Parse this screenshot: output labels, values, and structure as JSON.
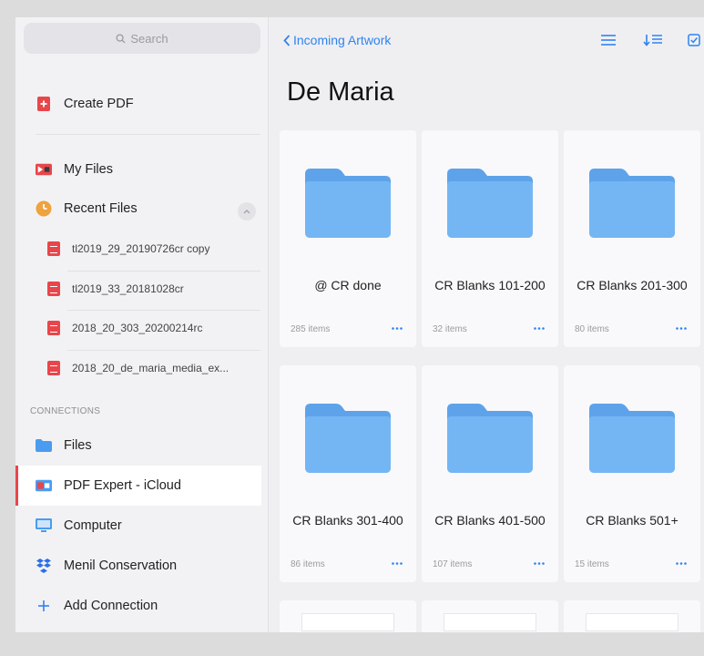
{
  "sidebar": {
    "search_placeholder": "Search",
    "create_pdf": "Create PDF",
    "my_files": "My Files",
    "recent_files": "Recent Files",
    "recent": [
      "tl2019_29_20190726cr copy",
      "tl2019_33_20181028cr",
      "2018_20_303_20200214rc",
      "2018_20_de_maria_media_ex..."
    ],
    "connections_title": "CONNECTIONS",
    "connections": [
      {
        "label": "Files",
        "icon": "folder-icon"
      },
      {
        "label": "PDF Expert - iCloud",
        "icon": "pdf-expert-cloud-icon"
      },
      {
        "label": "Computer",
        "icon": "computer-icon"
      },
      {
        "label": "Menil Conservation",
        "icon": "dropbox-icon"
      },
      {
        "label": "Add Connection",
        "icon": "plus-icon"
      }
    ]
  },
  "header": {
    "back_label": "Incoming Artwork",
    "title": "De Maria"
  },
  "folders": [
    {
      "name": "@ CR done",
      "count": "285 items"
    },
    {
      "name": "CR Blanks 101-200",
      "count": "32 items"
    },
    {
      "name": "CR Blanks 201-300",
      "count": "80 items"
    },
    {
      "name": "CR Blanks 301-400",
      "count": "86 items"
    },
    {
      "name": "CR Blanks 401-500",
      "count": "107 items"
    },
    {
      "name": "CR Blanks 501+",
      "count": "15 items"
    }
  ],
  "colors": {
    "accent": "#2f83f0",
    "brand_red": "#e8464b",
    "folder": "#6fb3f2"
  }
}
